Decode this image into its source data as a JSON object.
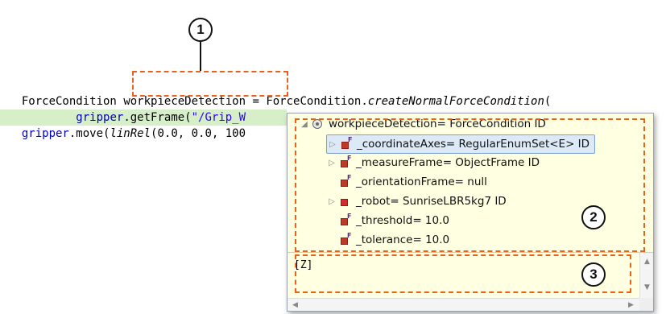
{
  "callouts": [
    "1",
    "2",
    "3"
  ],
  "code": {
    "line1": {
      "type": "ForceCondition",
      "variable": "workpieceDetection",
      "eq": " = ForceCondition.",
      "method": "createNormalForceCondition",
      "tail": "("
    },
    "line2": {
      "indent": "        ",
      "obj": "gripper",
      "call": ".getFrame(",
      "str": "\"/Grip_W"
    },
    "line3": {
      "obj": "gripper",
      "call": ".move(",
      "method": "linRel",
      "args": "(0.0, 0.0, 100"
    }
  },
  "popup": {
    "root": "workpieceDetection= ForceCondition ID",
    "items": [
      {
        "label": "_coordinateAxes= RegularEnumSet<E>  ID",
        "expandable": true,
        "selected": true
      },
      {
        "label": "_measureFrame= ObjectFrame  ID",
        "expandable": true,
        "selected": false
      },
      {
        "label": "_orientationFrame= null",
        "expandable": false,
        "selected": false
      },
      {
        "label": "_robot= SunriseLBR5kg7  ID",
        "expandable": true,
        "selected": false
      },
      {
        "label": "_threshold= 10.0",
        "expandable": false,
        "selected": false
      },
      {
        "label": "_tolerance= 10.0",
        "expandable": false,
        "selected": false
      }
    ],
    "detail_value": "[Z]"
  },
  "colors": {
    "annotation": "#e8621a",
    "keyword": "#0000c0",
    "string": "#2a00ff",
    "highlight": "#d7efc9",
    "popup_bg": "#ffffe1",
    "selection": "#dceaf8"
  },
  "icons": [
    "field-icon",
    "object-icon",
    "expand-icon",
    "collapse-icon"
  ]
}
